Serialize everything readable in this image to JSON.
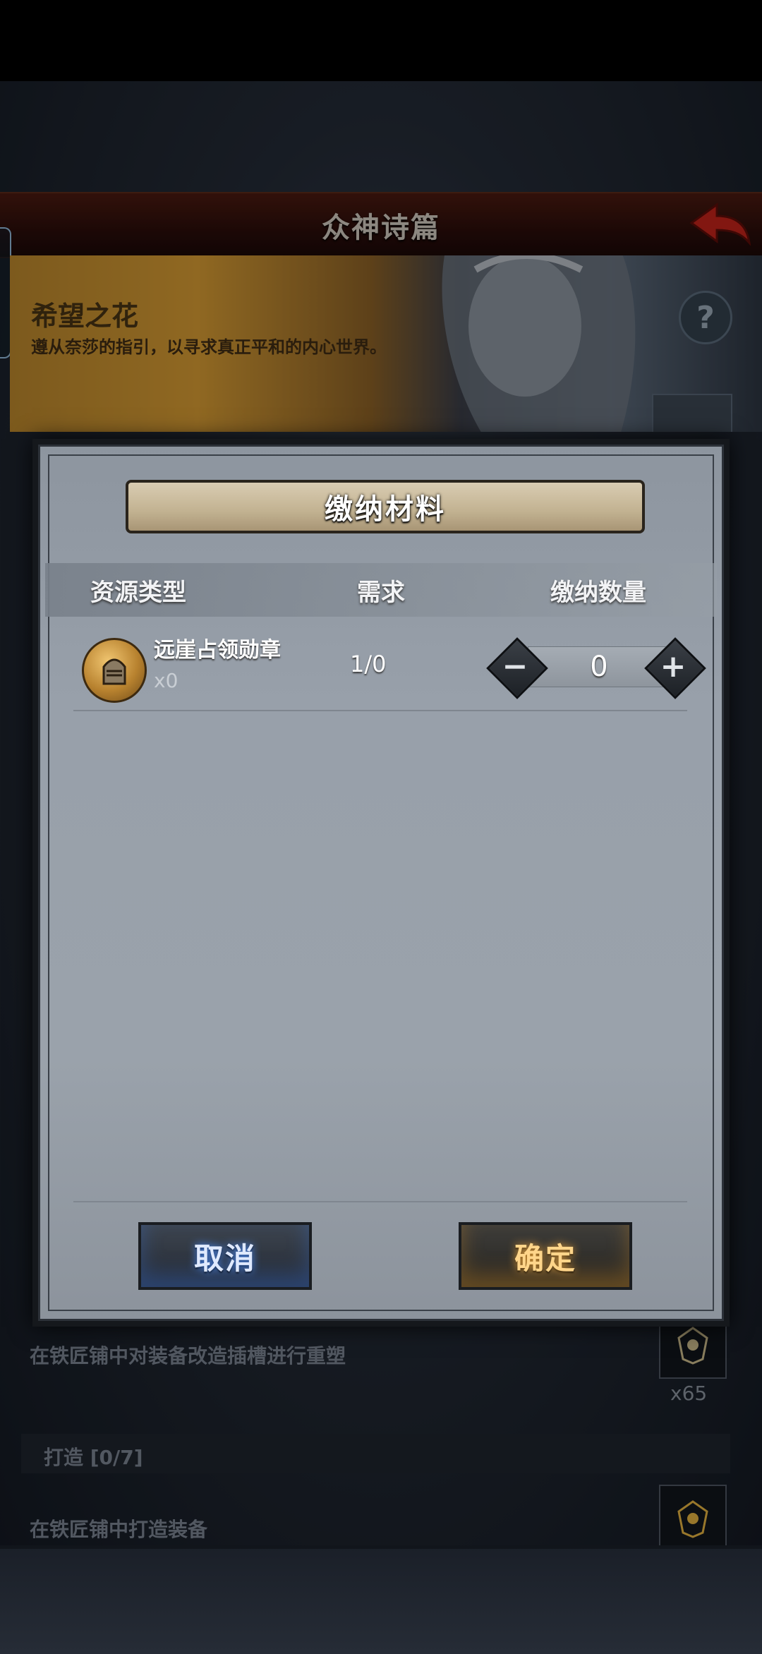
{
  "screen_title": "众神诗篇",
  "banner": {
    "title": "希望之花",
    "description": "遵从奈莎的指引，以寻求真正平和的内心世界。"
  },
  "background_tasks": [
    {
      "description": "在铁匠铺中对装备改造插槽进行重塑",
      "reward_count": "x65"
    },
    {
      "category": "打造 [0/7]",
      "description": "在铁匠铺中打造装备"
    }
  ],
  "dialog": {
    "title": "缴纳材料",
    "columns": [
      "资源类型",
      "需求",
      "缴纳数量"
    ],
    "rows": [
      {
        "icon": "knight-helmet-medal-icon",
        "name": "远崖占领勋章",
        "owned": "x0",
        "requirement": "1/0",
        "quantity": "0"
      }
    ],
    "cancel_label": "取消",
    "confirm_label": "确定"
  },
  "colors": {
    "cancel_glow": "#4a8dff",
    "confirm_glow": "#e8a23a",
    "title_bar": "#3a110c"
  }
}
